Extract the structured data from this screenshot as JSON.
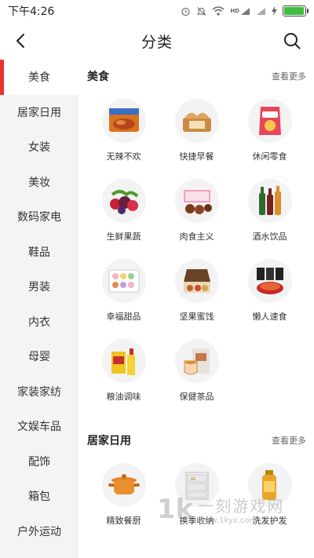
{
  "status_bar": {
    "time": "下午4:26",
    "icons": [
      "alarm-icon",
      "mute-icon",
      "wifi-icon",
      "hd-signal-icon",
      "signal-icon",
      "charging-icon",
      "battery-icon"
    ],
    "hd_label": "HD",
    "battery_level": 0.95,
    "battery_color": "#3fbf3f"
  },
  "header": {
    "title": "分类",
    "back_icon": "chevron-left-icon",
    "search_icon": "search-icon"
  },
  "sidebar": {
    "accent_color": "#e8322c",
    "items": [
      {
        "label": "美食",
        "active": true
      },
      {
        "label": "居家日用"
      },
      {
        "label": "女装"
      },
      {
        "label": "美妆"
      },
      {
        "label": "数码家电"
      },
      {
        "label": "鞋品"
      },
      {
        "label": "男装"
      },
      {
        "label": "内衣"
      },
      {
        "label": "母婴"
      },
      {
        "label": "家装家纺"
      },
      {
        "label": "文娱车品"
      },
      {
        "label": "配饰"
      },
      {
        "label": "箱包"
      },
      {
        "label": "户外运动"
      }
    ]
  },
  "sections": [
    {
      "title": "美食",
      "more": "查看更多",
      "items": [
        {
          "label": "无辣不欢",
          "icon": "jerky-pack-icon"
        },
        {
          "label": "快捷早餐",
          "icon": "bread-icon"
        },
        {
          "label": "休闲零食",
          "icon": "chips-bag-icon"
        },
        {
          "label": "生鲜果蔬",
          "icon": "berries-icon"
        },
        {
          "label": "肉食主义",
          "icon": "meat-box-icon"
        },
        {
          "label": "酒水饮品",
          "icon": "bottles-icon"
        },
        {
          "label": "幸福甜品",
          "icon": "macaron-box-icon"
        },
        {
          "label": "坚果蜜饯",
          "icon": "nuts-box-icon"
        },
        {
          "label": "懒人速食",
          "icon": "instant-noodles-icon"
        },
        {
          "label": "粮油调味",
          "icon": "oil-bottle-icon"
        },
        {
          "label": "保健茶品",
          "icon": "tea-box-icon"
        }
      ]
    },
    {
      "title": "居家日用",
      "more": "查看更多",
      "items": [
        {
          "label": "精致餐厨",
          "icon": "cooking-pot-icon"
        },
        {
          "label": "换季收纳",
          "icon": "storage-drawer-icon"
        },
        {
          "label": "洗发护发",
          "icon": "shampoo-bottle-icon"
        }
      ]
    }
  ],
  "watermark": {
    "logo": "1k",
    "text": "一刻游戏网",
    "url": "www.1kyx.com"
  }
}
